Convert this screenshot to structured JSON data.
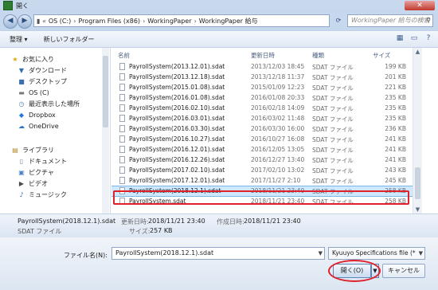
{
  "window": {
    "title": "開く",
    "close_label": "✕"
  },
  "address": {
    "segments": [
      "OS (C:)",
      "Program Files (x86)",
      "WorkingPaper",
      "WorkingPaper 給与"
    ],
    "search_placeholder": "WorkingPaper 給与の検索"
  },
  "toolbar": {
    "organize": "整理 ▾",
    "new_folder": "新しいフォルダー"
  },
  "nav": {
    "items": [
      {
        "icon": "★",
        "label": "お気に入り"
      },
      {
        "icon": "▼",
        "label": "ダウンロード"
      },
      {
        "icon": "■",
        "label": "デスクトップ"
      },
      {
        "icon": "▬",
        "label": "OS (C)"
      },
      {
        "icon": "◷",
        "label": "最近表示した場所"
      },
      {
        "icon": "◆",
        "label": "Dropbox"
      },
      {
        "icon": "☁",
        "label": "OneDrive"
      },
      {
        "icon": "▤",
        "label": "ライブラリ"
      },
      {
        "icon": "▯",
        "label": "ドキュメント"
      },
      {
        "icon": "▣",
        "label": "ピクチャ"
      },
      {
        "icon": "▶",
        "label": "ビデオ"
      },
      {
        "icon": "♪",
        "label": "ミュージック"
      }
    ]
  },
  "list": {
    "headers": {
      "name": "名前",
      "date": "更新日時",
      "type": "種類",
      "size": "サイズ"
    },
    "rows": [
      {
        "name": "PayrollSystem(2013.12.01).sdat",
        "date": "2013/12/03 18:45",
        "type": "SDAT ファイル",
        "size": "199 KB"
      },
      {
        "name": "PayrollSystem(2013.12.18).sdat",
        "date": "2013/12/18 11:37",
        "type": "SDAT ファイル",
        "size": "201 KB"
      },
      {
        "name": "PayrollSystem(2015.01.08).sdat",
        "date": "2015/01/09 12:23",
        "type": "SDAT ファイル",
        "size": "221 KB"
      },
      {
        "name": "PayrollSystem(2016.01.08).sdat",
        "date": "2016/01/08 20:33",
        "type": "SDAT ファイル",
        "size": "235 KB"
      },
      {
        "name": "PayrollSystem(2016.02.10).sdat",
        "date": "2016/02/18 14:09",
        "type": "SDAT ファイル",
        "size": "235 KB"
      },
      {
        "name": "PayrollSystem(2016.03.01).sdat",
        "date": "2016/03/02 11:48",
        "type": "SDAT ファイル",
        "size": "235 KB"
      },
      {
        "name": "PayrollSystem(2016.03.30).sdat",
        "date": "2016/03/30 16:00",
        "type": "SDAT ファイル",
        "size": "236 KB"
      },
      {
        "name": "PayrollSystem(2016.10.27).sdat",
        "date": "2016/10/27 16:08",
        "type": "SDAT ファイル",
        "size": "241 KB"
      },
      {
        "name": "PayrollSystem(2016.12.01).sdat",
        "date": "2016/12/05 13:05",
        "type": "SDAT ファイル",
        "size": "241 KB"
      },
      {
        "name": "PayrollSystem(2016.12.26).sdat",
        "date": "2016/12/27 13:40",
        "type": "SDAT ファイル",
        "size": "241 KB"
      },
      {
        "name": "PayrollSystem(2017.02.10).sdat",
        "date": "2017/02/10 13:02",
        "type": "SDAT ファイル",
        "size": "243 KB"
      },
      {
        "name": "PayrollSystem(2017.12.01).sdat",
        "date": "2017/11/27 2:10",
        "type": "SDAT ファイル",
        "size": "245 KB"
      },
      {
        "name": "PayrollSystem(2018.12.1).sdat",
        "date": "2018/11/21 23:40",
        "type": "SDAT ファイル",
        "size": "258 KB"
      },
      {
        "name": "PayrollSystem.sdat",
        "date": "2018/11/21 23:40",
        "type": "SDAT ファイル",
        "size": "258 KB"
      }
    ],
    "selected_index": 12
  },
  "details": {
    "file_name": "PayrollSystem(2018.12.1).sdat",
    "file_type": "SDAT ファイル",
    "modified_key": "更新日時:",
    "modified_val": "2018/11/21 23:40",
    "created_key": "作成日時:",
    "created_val": "2018/11/21 23:40",
    "size_key": "サイズ:",
    "size_val": "257 KB"
  },
  "bottom": {
    "file_name_label": "ファイル名(N):",
    "file_name_value": "PayrollSystem(2018.12.1).sdat",
    "filter_value": "Kyuuyo Specifications file (*",
    "open_label": "開く(O)",
    "cancel_label": "キャンセル"
  }
}
